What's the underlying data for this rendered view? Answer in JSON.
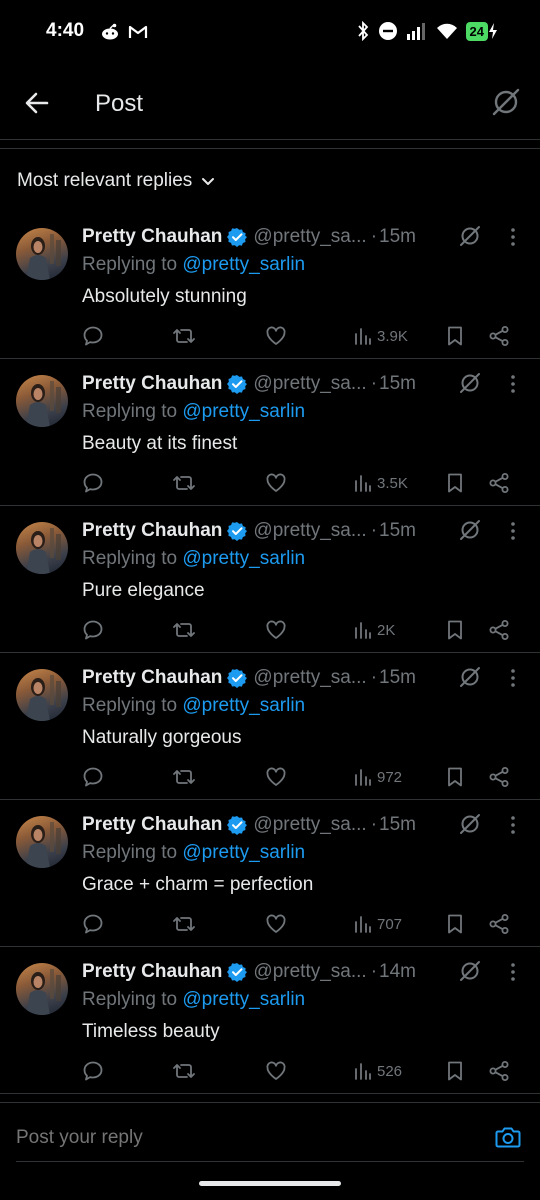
{
  "status_bar": {
    "time": "4:40",
    "battery": "24",
    "left_icons": [
      "reddit-icon",
      "gmail-icon"
    ],
    "right_icons": [
      "bluetooth-icon",
      "do-not-disturb-icon",
      "signal-icon",
      "wifi-icon",
      "battery-icon"
    ]
  },
  "header": {
    "title": "Post"
  },
  "sort": {
    "label": "Most relevant replies"
  },
  "replies": [
    {
      "name": "Pretty Chauhan",
      "handle": "@pretty_sa...",
      "dot": "·",
      "time": "15m",
      "replying_prefix": "Replying to ",
      "mention": "@pretty_sarlin",
      "text": "Absolutely stunning",
      "views": "3.9K"
    },
    {
      "name": "Pretty Chauhan",
      "handle": "@pretty_sa...",
      "dot": "·",
      "time": "15m",
      "replying_prefix": "Replying to ",
      "mention": "@pretty_sarlin",
      "text": "Beauty at its finest",
      "views": "3.5K"
    },
    {
      "name": "Pretty Chauhan",
      "handle": "@pretty_sa...",
      "dot": "·",
      "time": "15m",
      "replying_prefix": "Replying to ",
      "mention": "@pretty_sarlin",
      "text": "Pure elegance",
      "views": "2K"
    },
    {
      "name": "Pretty Chauhan",
      "handle": "@pretty_sa...",
      "dot": "·",
      "time": "15m",
      "replying_prefix": "Replying to ",
      "mention": "@pretty_sarlin",
      "text": "Naturally gorgeous",
      "views": "972"
    },
    {
      "name": "Pretty Chauhan",
      "handle": "@pretty_sa...",
      "dot": "·",
      "time": "15m",
      "replying_prefix": "Replying to ",
      "mention": "@pretty_sarlin",
      "text": "Grace + charm = perfection",
      "views": "707"
    },
    {
      "name": "Pretty Chauhan",
      "handle": "@pretty_sa...",
      "dot": "·",
      "time": "14m",
      "replying_prefix": "Replying to ",
      "mention": "@pretty_sarlin",
      "text": "Timeless beauty",
      "views": "526"
    }
  ],
  "compose": {
    "placeholder": "Post your reply"
  },
  "colors": {
    "background": "#000000",
    "text": "#e7e9ea",
    "muted": "#71767b",
    "accent": "#1d9bf0",
    "divider": "#2f3336",
    "battery": "#4cd964"
  }
}
